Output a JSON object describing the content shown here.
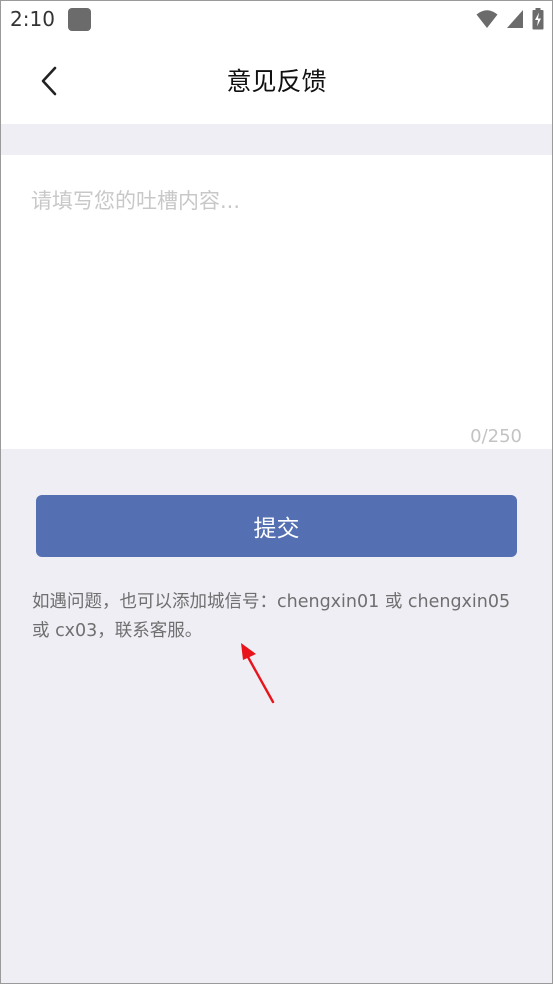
{
  "status_bar": {
    "time": "2:10",
    "icons": [
      "notification-icon",
      "wifi-icon",
      "signal-icon",
      "battery-charging-icon"
    ]
  },
  "header": {
    "title": "意见反馈",
    "back_icon": "chevron-left-icon"
  },
  "feedback": {
    "value": "",
    "placeholder": "请填写您的吐槽内容...",
    "char_count": "0/250"
  },
  "submit": {
    "label": "提交"
  },
  "notice": {
    "text": "如遇问题，也可以添加城信号：chengxin01 或 chengxin05 或 cx03，联系客服。"
  },
  "colors": {
    "accent": "#5470b2",
    "background": "#efeef4",
    "annotation": "#e8131b"
  }
}
